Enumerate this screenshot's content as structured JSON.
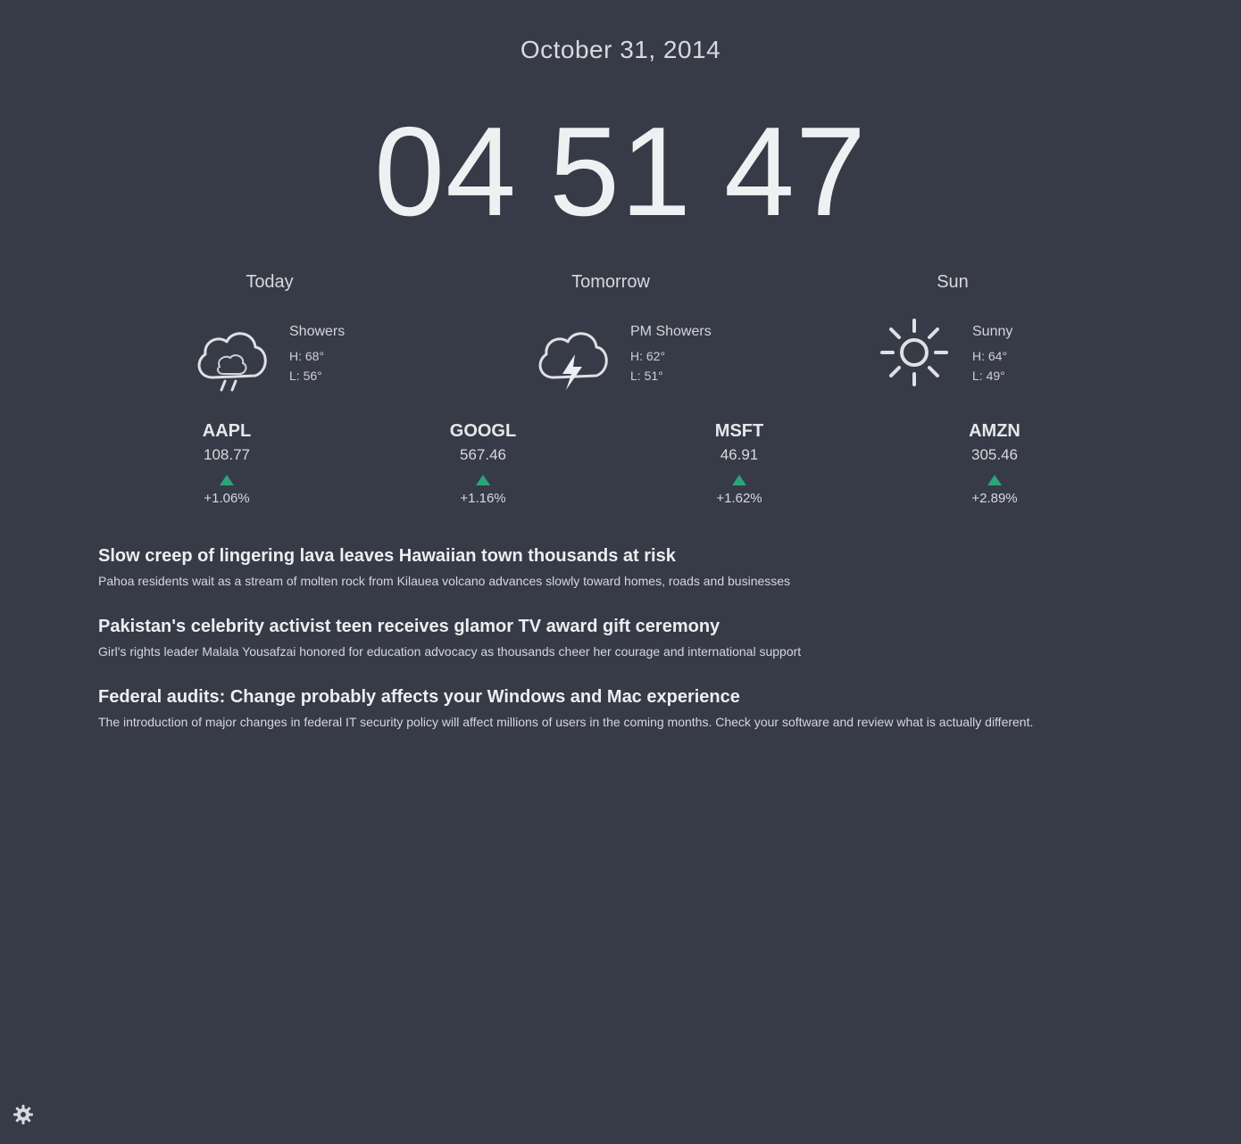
{
  "date": "October 31, 2014",
  "clock": {
    "hours": "04",
    "minutes": "51",
    "seconds": "47"
  },
  "forecast": [
    {
      "day": "Today",
      "icon": "rain-cloud-icon",
      "condition": "Showers",
      "high": "H: 68°",
      "low": "L: 56°"
    },
    {
      "day": "Tomorrow",
      "icon": "thunderstorm-cloud-icon",
      "condition": "PM Showers",
      "high": "H: 62°",
      "low": "L: 51°"
    },
    {
      "day": "Sun",
      "icon": "sun-icon",
      "condition": "Sunny",
      "high": "H: 64°",
      "low": "L: 49°"
    }
  ],
  "stocks": [
    {
      "symbol": "AAPL",
      "price": "108.77",
      "change": "+1.06%",
      "direction": "up"
    },
    {
      "symbol": "GOOGL",
      "price": "567.46",
      "change": "+1.16%",
      "direction": "up"
    },
    {
      "symbol": "MSFT",
      "price": "46.91",
      "change": "+1.62%",
      "direction": "up"
    },
    {
      "symbol": "AMZN",
      "price": "305.46",
      "change": "+2.89%",
      "direction": "up"
    }
  ],
  "news": [
    {
      "headline": "Slow creep of lingering lava leaves Hawaiian town thousands at risk",
      "summary": "Pahoa residents wait as a stream of molten rock from Kilauea volcano advances slowly toward homes, roads and businesses"
    },
    {
      "headline": "Pakistan's celebrity activist teen receives glamor TV award gift ceremony",
      "summary": "Girl's rights leader Malala Yousafzai honored for education advocacy as thousands cheer her courage and international support"
    },
    {
      "headline": "Federal audits: Change probably affects your Windows and Mac experience",
      "summary": "The introduction of major changes in federal IT security policy will affect millions of users in the coming months. Check your software and review what is actually different."
    }
  ],
  "colors": {
    "background": "#373a47",
    "accent_up": "#2aa47a"
  },
  "settings_icon": "gear-icon"
}
